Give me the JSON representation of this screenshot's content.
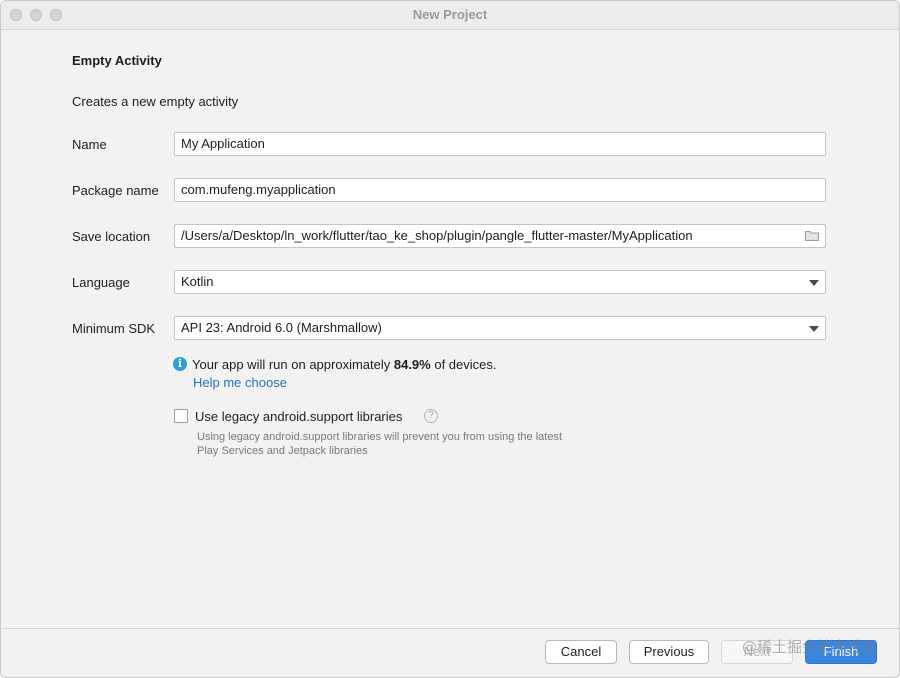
{
  "window": {
    "title": "New Project"
  },
  "form": {
    "heading": "Empty Activity",
    "description": "Creates a new empty activity",
    "name": {
      "label": "Name",
      "value": "My Application"
    },
    "package_name": {
      "label": "Package name",
      "value": "com.mufeng.myapplication"
    },
    "save_location": {
      "label": "Save location",
      "value": "/Users/a/Desktop/ln_work/flutter/tao_ke_shop/plugin/pangle_flutter-master/MyApplication"
    },
    "language": {
      "label": "Language",
      "value": "Kotlin"
    },
    "minimum_sdk": {
      "label": "Minimum SDK",
      "value": "API 23: Android 6.0 (Marshmallow)"
    }
  },
  "info": {
    "prefix": "Your app will run on approximately ",
    "percent": "84.9%",
    "suffix": " of devices.",
    "help_link": "Help me choose"
  },
  "legacy": {
    "label": "Use legacy android.support libraries",
    "checked": false,
    "description": "Using legacy android.support libraries will prevent you from using the latest Play Services and Jetpack libraries"
  },
  "buttons": {
    "cancel": "Cancel",
    "previous": "Previous",
    "next": "Next",
    "finish": "Finish"
  },
  "watermark": "@稀土掘金技术社区",
  "colors": {
    "accent": "#3b87e0",
    "link": "#2a73b8",
    "info_icon": "#2f9fd8"
  },
  "icons": {
    "info": "info-icon",
    "help": "question-icon",
    "folder": "folder-icon",
    "dropdown": "chevron-down-icon"
  }
}
